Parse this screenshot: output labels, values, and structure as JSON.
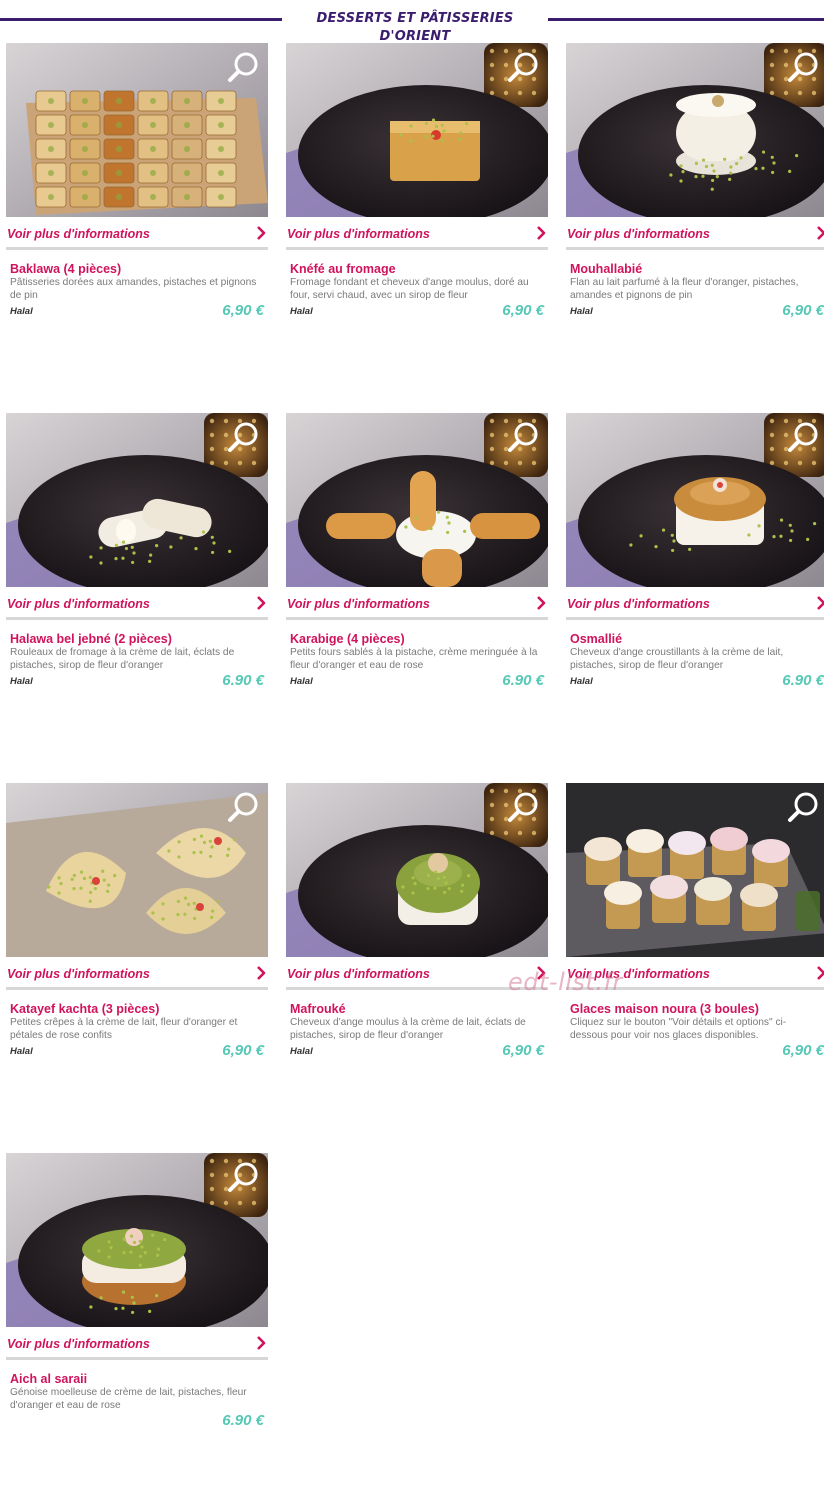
{
  "section": {
    "title": "DESSERTS ET PÂTISSERIES D'ORIENT"
  },
  "more_info_label": "Voir plus d'informations",
  "watermark": "edt-list.fr",
  "colors": {
    "accent": "#d0135c",
    "price": "#55c8b6",
    "header": "#3b1d6e"
  },
  "products": [
    {
      "name": "Baklawa (4 pièces)",
      "description": "Pâtisseries dorées aux amandes, pistaches et pignons de pin",
      "tag": "Halal",
      "price": "6,90 €",
      "image": "baklawa-tray"
    },
    {
      "name": "Knéfé au fromage",
      "description": "Fromage fondant et cheveux d'ange moulus, doré au four, servi chaud, avec un sirop de fleur",
      "tag": "Halal",
      "price": "6,90 €",
      "image": "square-cake-plate"
    },
    {
      "name": "Mouhallabié",
      "description": "Flan au lait parfumé à la fleur d'oranger, pistaches, amandes et pignons de pin",
      "tag": "Halal",
      "price": "6,90 €",
      "image": "white-flan-plate"
    },
    {
      "name": "Halawa bel jebné (2 pièces)",
      "description": "Rouleaux de fromage à la crème de lait, éclats de pistaches, sirop de fleur d'oranger",
      "tag": "Halal",
      "price": "6.90 €",
      "image": "cheese-rolls-plate"
    },
    {
      "name": "Karabige (4 pièces)",
      "description": "Petits fours sablés à la pistache, crème meringuée à la fleur d'oranger et eau de rose",
      "tag": "Halal",
      "price": "6.90 €",
      "image": "fingers-cream-plate"
    },
    {
      "name": "Osmallié",
      "description": "Cheveux d'ange croustillants à la crème de lait, pistaches, sirop de fleur d'oranger",
      "tag": "Halal",
      "price": "6.90 €",
      "image": "golden-cake-plate"
    },
    {
      "name": "Katayef kachta (3 pièces)",
      "description": "Petites crêpes à la crème de lait, fleur d'oranger et pétales de rose confits",
      "tag": "Halal",
      "price": "6,90 €",
      "image": "katayef-paper"
    },
    {
      "name": "Mafrouké",
      "description": "Cheveux d'ange moulus à la crème de lait, éclats de pistaches, sirop de fleur d'oranger",
      "tag": "Halal",
      "price": "6,90 €",
      "image": "pistachio-dome-plate"
    },
    {
      "name": "Glaces maison noura (3 boules)",
      "description": "Cliquez sur le bouton \"Voir détails et options\" ci-dessous pour voir nos glaces disponibles.",
      "tag": "",
      "price": "6,90 €",
      "image": "ice-cream-cups"
    },
    {
      "name": "Aich al saraii",
      "description": "Génoise moelleuse de crème de lait, pistaches, fleur d'oranger et eau de rose",
      "tag": "",
      "price": "6.90 €",
      "image": "round-cake-plate"
    }
  ]
}
